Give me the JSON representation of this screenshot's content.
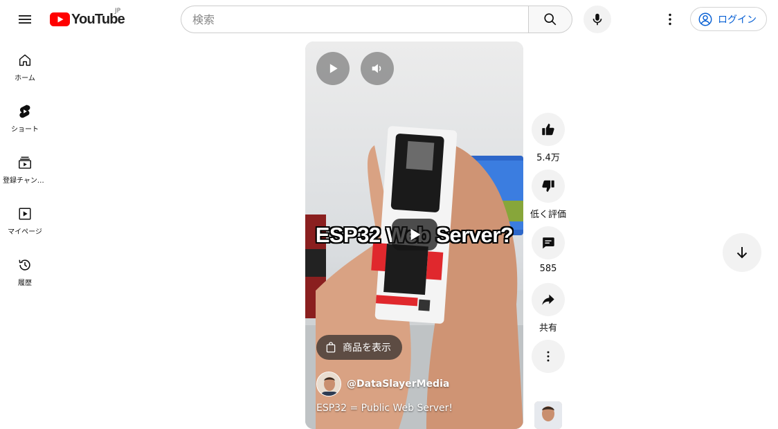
{
  "header": {
    "logo_text": "YouTube",
    "region": "JP",
    "search_placeholder": "検索",
    "login_label": "ログイン"
  },
  "sidebar": {
    "items": [
      {
        "label": "ホーム",
        "icon": "home-icon"
      },
      {
        "label": "ショート",
        "icon": "shorts-icon"
      },
      {
        "label": "登録チャンネル",
        "icon": "subscriptions-icon"
      },
      {
        "label": "マイページ",
        "icon": "you-icon"
      },
      {
        "label": "履歴",
        "icon": "history-icon"
      }
    ]
  },
  "video": {
    "overlay_title": "ESP32 Web Server?",
    "products_label": "商品を表示",
    "channel_name": "@DataSlayerMedia",
    "title": "ESP32 = Public Web Server!"
  },
  "actions": {
    "like_count": "5.4万",
    "dislike_label": "低く評価",
    "comment_count": "585",
    "share_label": "共有"
  },
  "colors": {
    "brand_red": "#ff0000",
    "link_blue": "#065fd4"
  }
}
